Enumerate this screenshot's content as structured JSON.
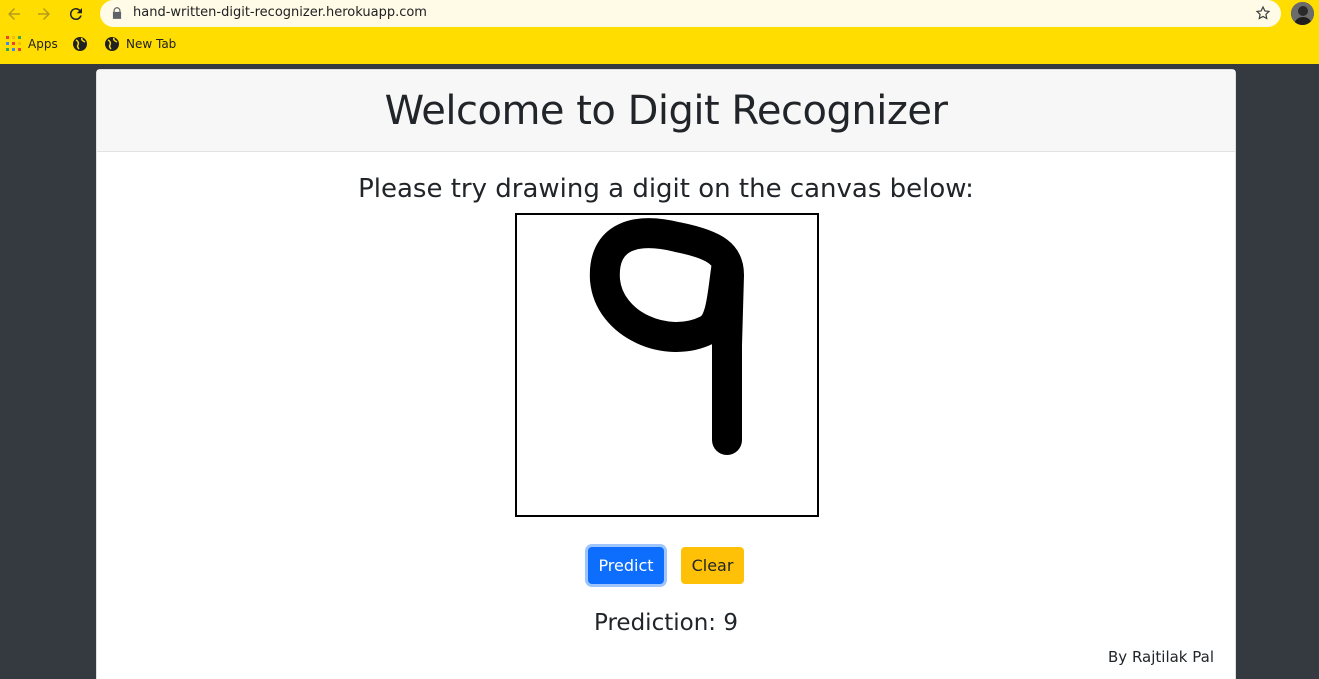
{
  "browser": {
    "url": "hand-written-digit-recognizer.herokuapp.com",
    "bookmarks": [
      {
        "label": "Apps",
        "icon": "apps-grid-icon"
      },
      {
        "label": "",
        "icon": "globe-icon"
      },
      {
        "label": "New Tab",
        "icon": "globe-icon"
      }
    ],
    "chrome_color": "#ffdd00"
  },
  "page": {
    "title": "Welcome to Digit Recognizer",
    "instruction": "Please try drawing a digit on the canvas below:",
    "predict_label": "Predict",
    "clear_label": "Clear",
    "prediction_text": "Prediction: 9",
    "author": "By Rajtilak Pal",
    "drawn_digit": "9"
  },
  "colors": {
    "background": "#343a40",
    "predict_button": "#0d6efd",
    "clear_button": "#ffc107"
  }
}
